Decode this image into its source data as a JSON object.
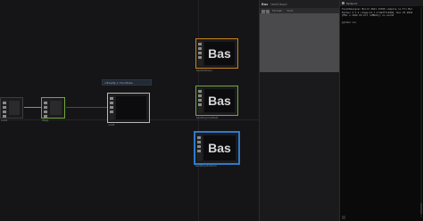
{
  "network": {
    "nodes": [
      {
        "id": "source_a",
        "label": "",
        "border": "#3c3c3e"
      },
      {
        "id": "source_b",
        "label": "",
        "border": "#6fa83a"
      },
      {
        "id": "merge",
        "label": "",
        "border": "#b8b8b8"
      },
      {
        "id": "top_bas",
        "label": "Bas",
        "border": "#c8821e"
      },
      {
        "id": "middle_bas",
        "label": "Bas",
        "border": "#6fa83a"
      },
      {
        "id": "bottom_bas",
        "label": "Bas",
        "border": "#2f79c8"
      }
    ],
    "captions": {
      "source_a": "null1",
      "source_b": "ifbg1",
      "merge": "null2",
      "top_bas": "text/td/top1",
      "middle_bas": "text/top/midtext",
      "bottom_bas": "text/top/bottom"
    },
    "tooltip": "cdtop/fg.1 chordtube"
  },
  "panel": {
    "title": "Bas",
    "subtitle": "text1/top1",
    "tabs": [
      "Text",
      "Format",
      "Font"
    ]
  },
  "textport": {
    "title": "Textport",
    "lines": [
      "TouchDesigner  Build 2021.13700 compile on Fri Mar",
      "Python 3.7.2 (tags/v3.7.2:9a3ffc0492, Dec 23 2018",
      "[MSC v.1916 64 bit (AMD64)] on win32",
      "",
      "python >>>"
    ]
  },
  "colors": {
    "canvas_bg": "#151517",
    "accent_orange": "#c8821e",
    "accent_green": "#6fa83a",
    "accent_blue": "#2f79c8"
  }
}
